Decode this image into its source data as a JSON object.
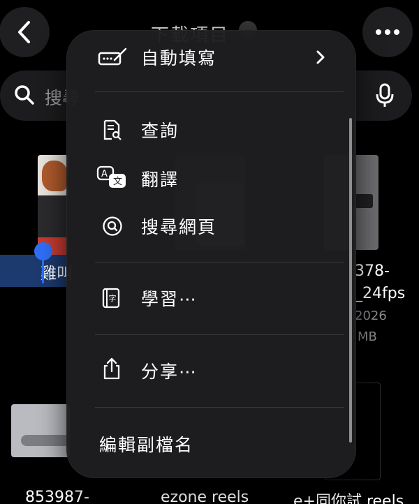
{
  "nav": {
    "title": "下載項目",
    "back_icon": "chevron-left-icon",
    "more_icon": "ellipsis-icon"
  },
  "search": {
    "text": "搜尋",
    "icon": "search-icon",
    "mic_icon": "mic-icon"
  },
  "files": {
    "selected_name": "雞叫",
    "right_lines": [
      "378-",
      "_24fps",
      "2026",
      "MB"
    ],
    "bottom_names": [
      "853987-",
      "ezone reels",
      "e+同你試 reels"
    ]
  },
  "menu": {
    "items": [
      {
        "label": "自動填寫",
        "icon": "autofill-signature-icon",
        "has_submenu": true
      },
      {
        "label": "查詢",
        "icon": "lookup-document-icon"
      },
      {
        "label": "翻譯",
        "icon": "translate-icon"
      },
      {
        "label": "搜尋網頁",
        "icon": "web-search-icon"
      },
      {
        "label": "學習⋯",
        "icon": "learn-book-icon"
      },
      {
        "label": "分享⋯",
        "icon": "share-icon"
      },
      {
        "label": "編輯副檔名",
        "icon": ""
      }
    ]
  },
  "colors": {
    "menu_bg": "#1e1e20",
    "selection": "#2f6ff6",
    "text": "#ffffff",
    "secondary": "#8e8e93"
  }
}
